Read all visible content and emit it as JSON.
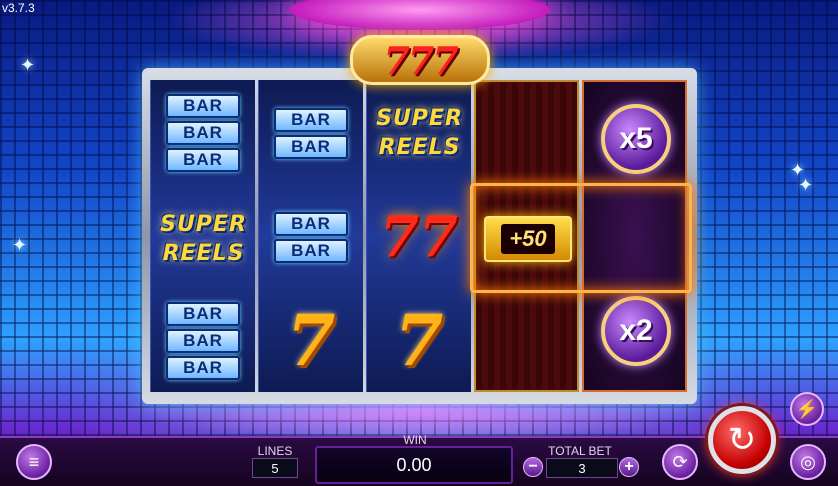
{
  "version": "v3.7.3",
  "logo": {
    "text": "777"
  },
  "reels": {
    "bar_label": "BAR",
    "super_line1": "SUPER",
    "super_line2": "REELS",
    "seven": "7",
    "multipliers": [
      "x5",
      "x2"
    ],
    "bonus": "+50"
  },
  "controls": {
    "lines_label": "LINES",
    "lines_value": "5",
    "win_label": "WIN",
    "win_value": "0.00",
    "total_bet_label": "TOTAL BET",
    "total_bet_value": "3",
    "minus": "−",
    "plus": "+"
  },
  "icons": {
    "menu": "≡",
    "autoplay": "⟳",
    "turbo": "⚡",
    "spin": "↻",
    "coins": "◎"
  },
  "colors": {
    "accent": "#8a3ac0",
    "spin": "#c40000",
    "gold": "#ffd83a"
  }
}
